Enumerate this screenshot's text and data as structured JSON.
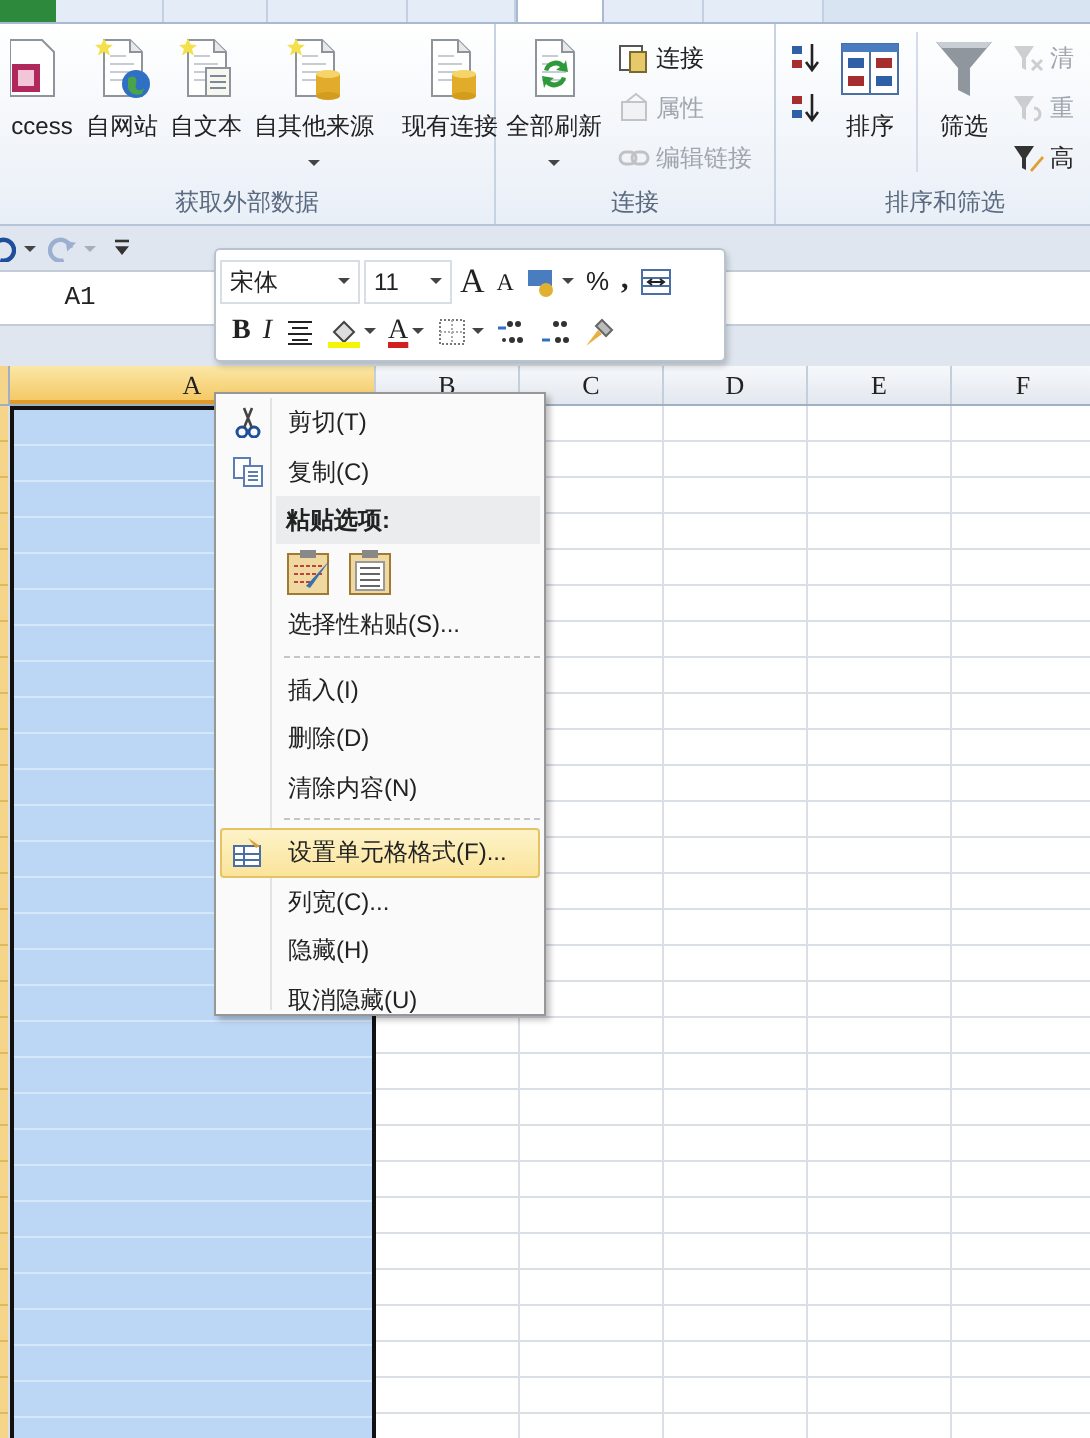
{
  "ribbon_tabs": [
    {
      "kind": "file",
      "selected": false
    },
    {
      "kind": "tab",
      "selected": false
    },
    {
      "kind": "tab",
      "selected": false
    },
    {
      "kind": "tab",
      "selected": false
    },
    {
      "kind": "tab",
      "selected": false
    },
    {
      "kind": "tab",
      "selected": true
    },
    {
      "kind": "tab",
      "selected": false
    },
    {
      "kind": "tab",
      "selected": false
    }
  ],
  "ribbon_groups": [
    {
      "label": "获取外部数据",
      "items": [
        {
          "kind": "large",
          "label": "ccess",
          "dropdown": false
        },
        {
          "kind": "large",
          "label": "自网站",
          "dropdown": false
        },
        {
          "kind": "large",
          "label": "自文本",
          "dropdown": false
        },
        {
          "kind": "large",
          "label": "自其他来源",
          "dropdown": true
        },
        {
          "kind": "divider"
        },
        {
          "kind": "large",
          "label": "现有连接",
          "dropdown": false
        }
      ]
    },
    {
      "label": "连接",
      "items": [
        {
          "kind": "large",
          "label": "全部刷新",
          "dropdown": true
        },
        {
          "kind": "stack",
          "items": [
            {
              "label": "连接",
              "disabled": false
            },
            {
              "label": "属性",
              "disabled": true
            },
            {
              "label": "编辑链接",
              "disabled": true
            }
          ]
        }
      ]
    },
    {
      "label": "排序和筛选",
      "items": [
        {
          "kind": "stack",
          "items": [
            {
              "disabled": false
            },
            {
              "disabled": false
            }
          ]
        },
        {
          "kind": "large",
          "label": "排序",
          "dropdown": false
        },
        {
          "kind": "divider"
        },
        {
          "kind": "large",
          "label": "筛选",
          "dropdown": false
        },
        {
          "kind": "stack",
          "items": [
            {
              "label": "清",
              "disabled": true
            },
            {
              "label": "重",
              "disabled": true
            },
            {
              "label": "高",
              "disabled": false
            }
          ]
        }
      ]
    }
  ],
  "quick_access": [
    {
      "kind": "undo",
      "disabled": false
    },
    {
      "kind": "redo",
      "disabled": true
    },
    {
      "kind": "customize",
      "disabled": false
    }
  ],
  "name_box": {
    "value": "A1"
  },
  "mini_toolbar": {
    "rows": [
      {
        "items": [
          {
            "kind": "combo",
            "value": "宋体"
          },
          {
            "kind": "combo",
            "value": "11"
          },
          {
            "kind": "grow-glyph",
            "text": "A"
          },
          {
            "kind": "shrink-glyph",
            "text": "A"
          },
          {
            "kind": "accounting",
            "dropdown": true
          },
          {
            "kind": "percent",
            "text": "%"
          },
          {
            "kind": "comma",
            "text": ","
          },
          {
            "kind": "merge"
          }
        ]
      },
      {
        "items": [
          {
            "kind": "bold-glyph",
            "text": "B"
          },
          {
            "kind": "italic-glyph",
            "text": "I"
          },
          {
            "kind": "center"
          },
          {
            "kind": "fill-color",
            "dropdown": true
          },
          {
            "kind": "font-color",
            "text": "A",
            "dropdown": true
          },
          {
            "kind": "borders",
            "dropdown": true
          },
          {
            "kind": "increase-decimal"
          },
          {
            "kind": "decrease-decimal"
          },
          {
            "kind": "format-painter"
          }
        ]
      }
    ]
  },
  "columns": [
    {
      "label": "A",
      "selected": true
    },
    {
      "label": "B",
      "selected": false
    },
    {
      "label": "C",
      "selected": false
    },
    {
      "label": "D",
      "selected": false
    },
    {
      "label": "E",
      "selected": false
    },
    {
      "label": "F",
      "selected": false
    }
  ],
  "context_menu": {
    "items": [
      {
        "kind": "command",
        "text": "剪切(T)",
        "selected": false
      },
      {
        "kind": "command",
        "text": "复制(C)",
        "selected": false
      },
      {
        "kind": "header",
        "text": "粘贴选项:"
      },
      {
        "kind": "paste-options"
      },
      {
        "kind": "command",
        "text": "选择性粘贴(S)...",
        "selected": false
      },
      {
        "kind": "separator"
      },
      {
        "kind": "command",
        "text": "插入(I)",
        "selected": false
      },
      {
        "kind": "command",
        "text": "删除(D)",
        "selected": false
      },
      {
        "kind": "command",
        "text": "清除内容(N)",
        "selected": false
      },
      {
        "kind": "separator"
      },
      {
        "kind": "command",
        "text": "设置单元格格式(F)...",
        "selected": true
      },
      {
        "kind": "command",
        "text": "列宽(C)...",
        "selected": false
      },
      {
        "kind": "command",
        "text": "隐藏(H)",
        "selected": false
      },
      {
        "kind": "command",
        "text": "取消隐藏(U)",
        "selected": false
      }
    ]
  }
}
